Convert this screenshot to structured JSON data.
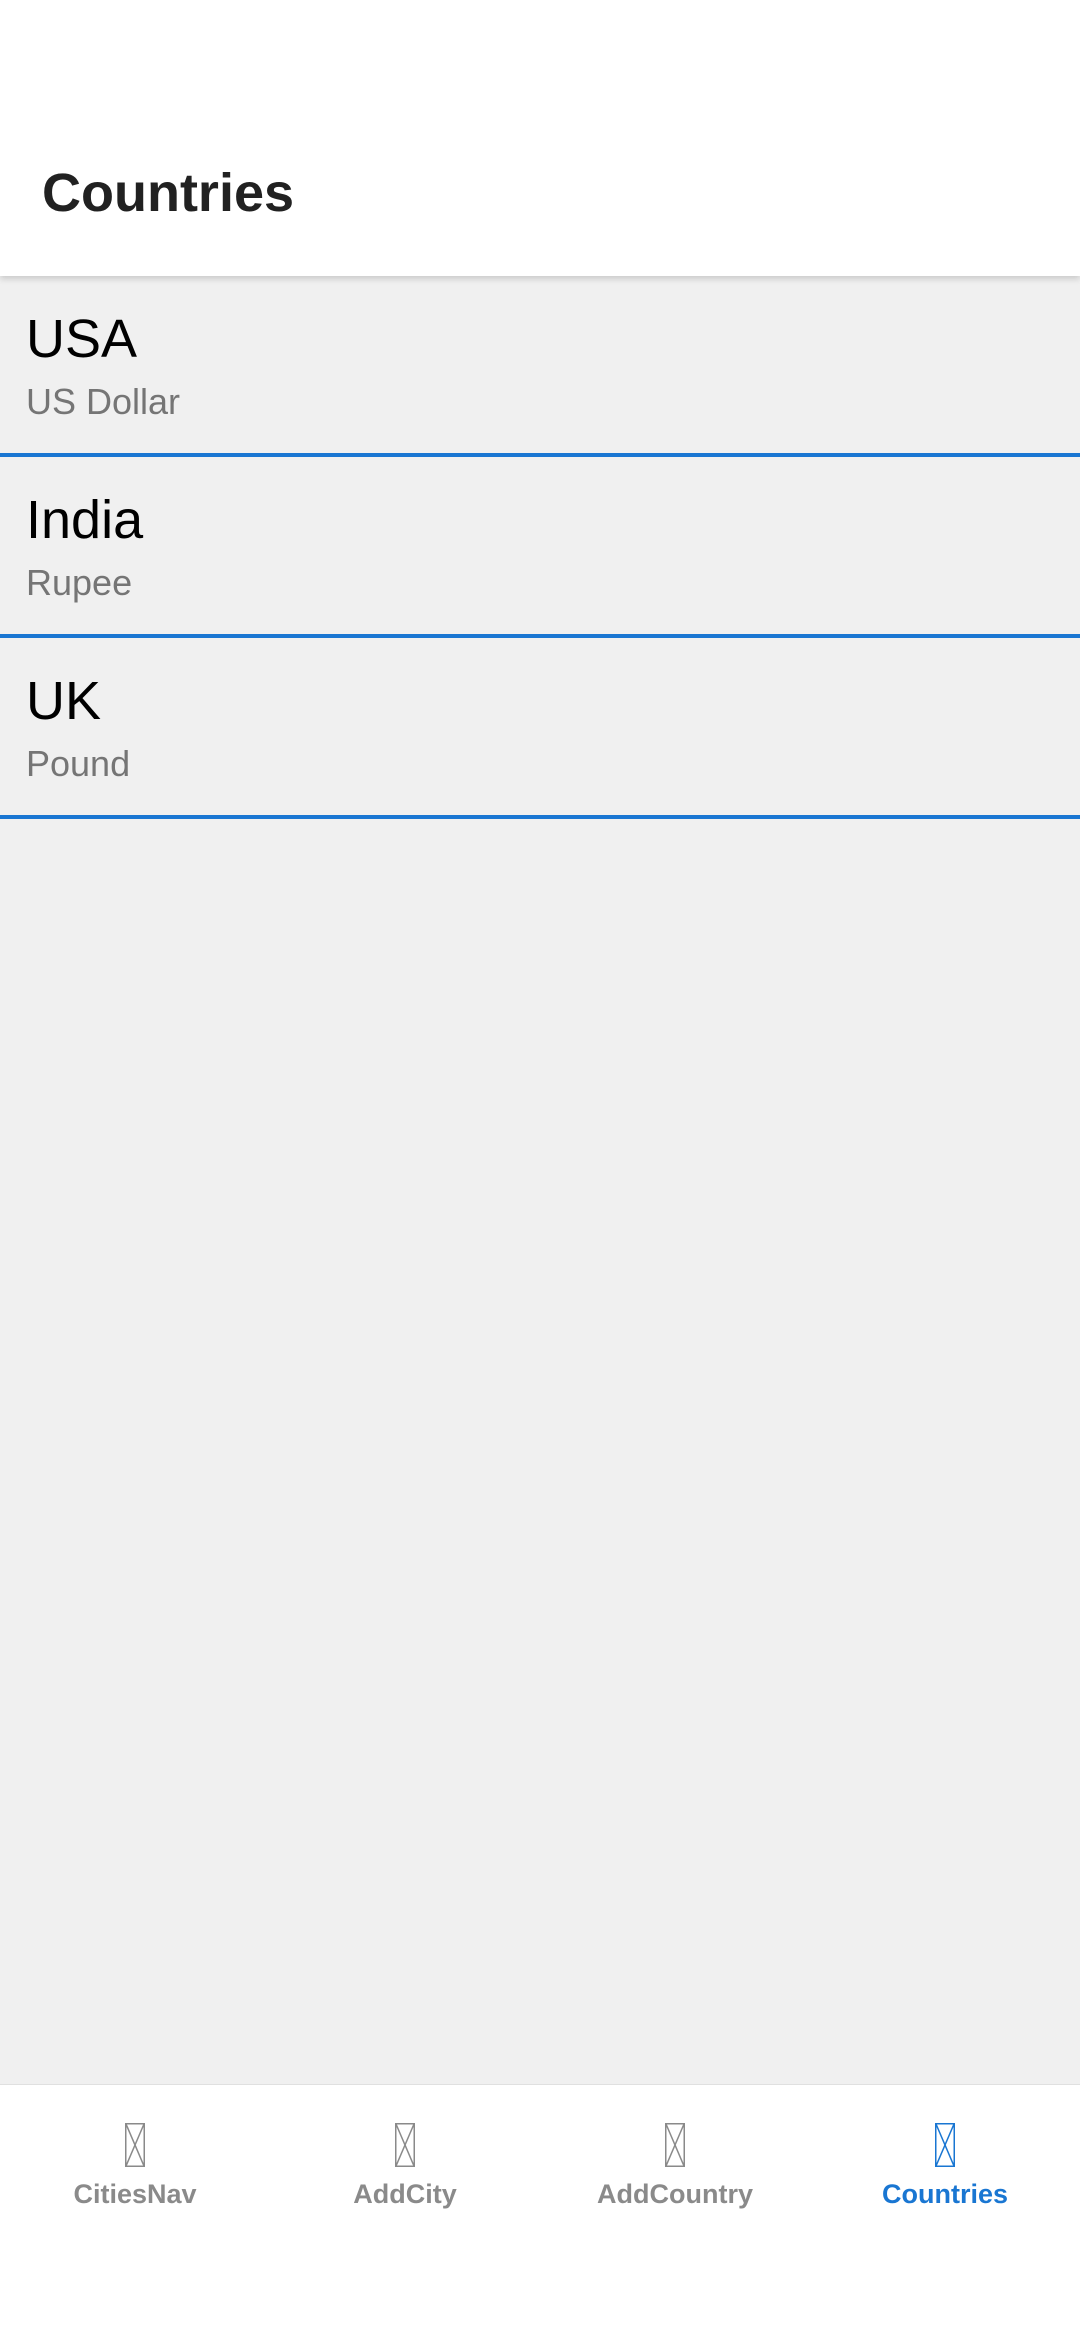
{
  "header": {
    "title": "Countries"
  },
  "countries": [
    {
      "name": "USA",
      "currency": "US Dollar"
    },
    {
      "name": "India",
      "currency": "Rupee"
    },
    {
      "name": "UK",
      "currency": "Pound"
    }
  ],
  "bottom_nav": {
    "items": [
      {
        "label": "CitiesNav",
        "icon": "missing-image-icon",
        "active": false
      },
      {
        "label": "AddCity",
        "icon": "missing-image-icon",
        "active": false
      },
      {
        "label": "AddCountry",
        "icon": "missing-image-icon",
        "active": false
      },
      {
        "label": "Countries",
        "icon": "missing-image-icon",
        "active": true
      }
    ]
  },
  "colors": {
    "accent": "#1976d2",
    "background": "#f0f0f0",
    "header_bg": "#ffffff",
    "inactive_nav": "#8a8a8a",
    "secondary_text": "#757575"
  }
}
